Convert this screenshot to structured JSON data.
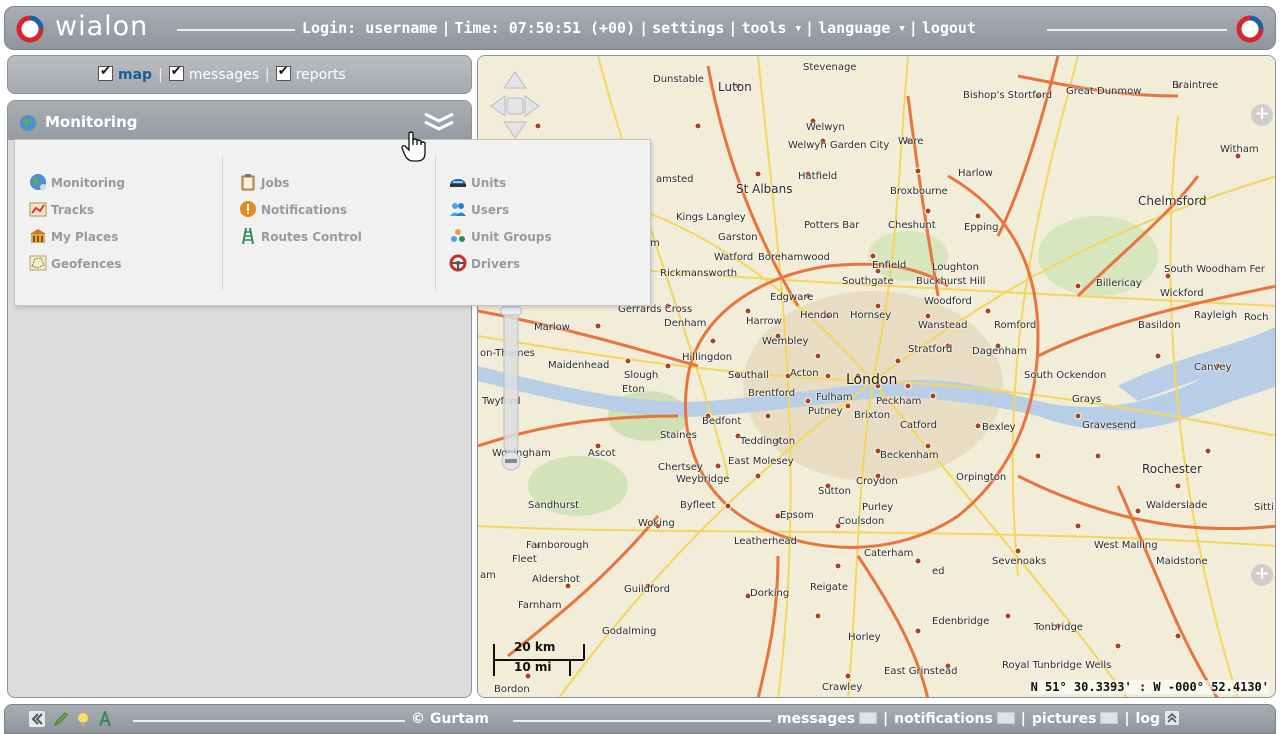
{
  "header": {
    "logo_text": "wialon",
    "login_label": "Login:",
    "login_value": "username",
    "time_label": "Time:",
    "time_value": "07:50:51 (+00)",
    "settings": "settings",
    "tools": "tools",
    "language": "language",
    "logout": "logout"
  },
  "tabs": {
    "map": "map",
    "messages": "messages",
    "reports": "reports"
  },
  "panel": {
    "title": "Monitoring"
  },
  "menu": {
    "col1": [
      "Monitoring",
      "Tracks",
      "My Places",
      "Geofences"
    ],
    "col2": [
      "Jobs",
      "Notifications",
      "Routes Control"
    ],
    "col3": [
      "Units",
      "Users",
      "Unit Groups",
      "Drivers"
    ]
  },
  "map": {
    "cities": {
      "stevenage": "Stevenage",
      "dunstable": "Dunstable",
      "luton": "Luton",
      "bishops": "Bishop's Stortford",
      "greatdunmow": "Great Dunmow",
      "braintree": "Braintree",
      "welwyn": "Welwyn",
      "welwyngc": "Welwyn Garden City",
      "ware": "Ware",
      "witham": "Witham",
      "hatfield": "Hatfield",
      "harlow": "Harlow",
      "stalbans": "St Albans",
      "broxbourne": "Broxbourne",
      "chelmsford": "Chelmsford",
      "kingslangley": "Kings Langley",
      "pottersbar": "Potters Bar",
      "cheshunt": "Cheshunt",
      "epping": "Epping",
      "garston": "Garston",
      "watford": "Watford",
      "borehamwood": "Borehamwood",
      "enfield": "Enfield",
      "loughton": "Loughton",
      "rickmansworth": "Rickmansworth",
      "southgate": "Southgate",
      "buckhurst": "Buckhurst Hill",
      "billericay": "Billericay",
      "southwoodham": "South Woodham Fer",
      "wickford": "Wickford",
      "edgware": "Edgware",
      "woodford": "Woodford",
      "gerrards": "Gerrards Cross",
      "harrow": "Harrow",
      "hendon": "Hendon",
      "hornsey": "Hornsey",
      "wanstead": "Wanstead",
      "romford": "Romford",
      "basildon": "Basildon",
      "rayleigh": "Rayleigh",
      "roch": "Roch",
      "marlow": "Marlow",
      "denham": "Denham",
      "wembley": "Wembley",
      "stratford": "Stratford",
      "dagenham": "Dagenham",
      "onthames": "on-Thames",
      "maidenhead": "Maidenhead",
      "hillingdon": "Hillingdon",
      "canvey": "Canvey",
      "slough": "Slough",
      "eton": "Eton",
      "southall": "Southall",
      "acton": "Acton",
      "london": "London",
      "southockendon": "South Ockendon",
      "brentford": "Brentford",
      "fulham": "Fulham",
      "peckham": "Peckham",
      "twyford": "Twyford",
      "putney": "Putney",
      "brixton": "Brixton",
      "grays": "Grays",
      "bedfont": "Bedfont",
      "catford": "Catford",
      "bexley": "Bexley",
      "gravesend": "Gravesend",
      "staines": "Staines",
      "teddington": "Teddington",
      "wokingham": "Wokingham",
      "ascot": "Ascot",
      "beckenham": "Beckenham",
      "chertsey": "Chertsey",
      "eastmolesey": "East Molesey",
      "orpington": "Orpington",
      "rochester": "Rochester",
      "weybridge": "Weybridge",
      "sutton": "Sutton",
      "croydon": "Croydon",
      "sandhurst": "Sandhurst",
      "byfleet": "Byfleet",
      "purley": "Purley",
      "walderslade": "Walderslade",
      "sitti": "Sitti",
      "woking": "Woking",
      "epsom": "Epsom",
      "coulsdon": "Coulsdon",
      "farnborough": "Farnborough",
      "leatherhead": "Leatherhead",
      "westmalling": "West Malling",
      "fleet": "Fleet",
      "caterham": "Caterham",
      "sevenoaks": "Sevenoaks",
      "maidstone": "Maidstone",
      "ed": "ed",
      "aldershot": "Aldershot",
      "guildford": "Guildford",
      "dorking": "Dorking",
      "reigate": "Reigate",
      "am": "am",
      "farnham": "Farnham",
      "edenbridge": "Edenbridge",
      "tonbridge": "Tonbridge",
      "godalming": "Godalming",
      "horley": "Horley",
      "eastgrinstead": "East Grinstead",
      "royaltw": "Royal Tunbridge Wells",
      "bordon": "Bordon",
      "crawley": "Crawley",
      "amsted": "amsted",
      "m": "m"
    },
    "scale_km": "20 km",
    "scale_mi": "10 mi",
    "coords": "N 51° 30.3393' : W -000° 52.4130'"
  },
  "footer": {
    "copyright": "© Gurtam",
    "messages": "messages",
    "notifications": "notifications",
    "pictures": "pictures",
    "log": "log"
  }
}
